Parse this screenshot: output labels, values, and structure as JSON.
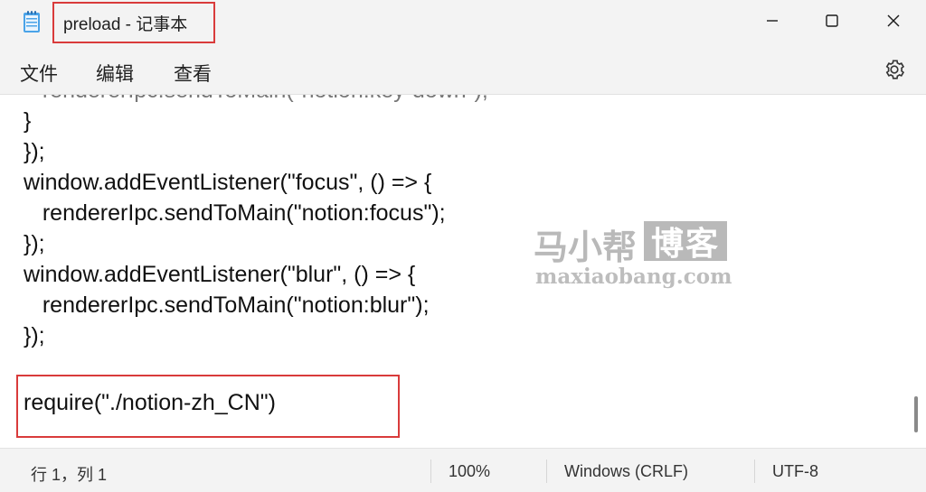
{
  "window": {
    "title": "preload - 记事本",
    "icon": "notepad-icon",
    "controls": [
      "minimize-icon",
      "maximize-icon",
      "close-icon"
    ]
  },
  "menu": {
    "items": [
      "文件",
      "编辑",
      "查看"
    ],
    "settings_icon": "gear-icon"
  },
  "editor": {
    "lines": [
      "}",
      "});",
      "window.addEventListener(\"focus\", () => {",
      "   rendererIpc.sendToMain(\"notion:focus\");",
      "});",
      "window.addEventListener(\"blur\", () => {",
      "   rendererIpc.sendToMain(\"notion:blur\");",
      "});",
      "",
      "require(\"./notion-zh_CN\")"
    ]
  },
  "watermark": {
    "name": "马小帮",
    "badge": "博客",
    "url": "maxiaobang.com"
  },
  "status": {
    "position": "行 1，列 1",
    "zoom": "100%",
    "line_ending": "Windows (CRLF)",
    "encoding": "UTF-8"
  },
  "colors": {
    "annotation_red": "#d93b3b",
    "background": "#f3f3f3",
    "editor_bg": "#ffffff"
  }
}
